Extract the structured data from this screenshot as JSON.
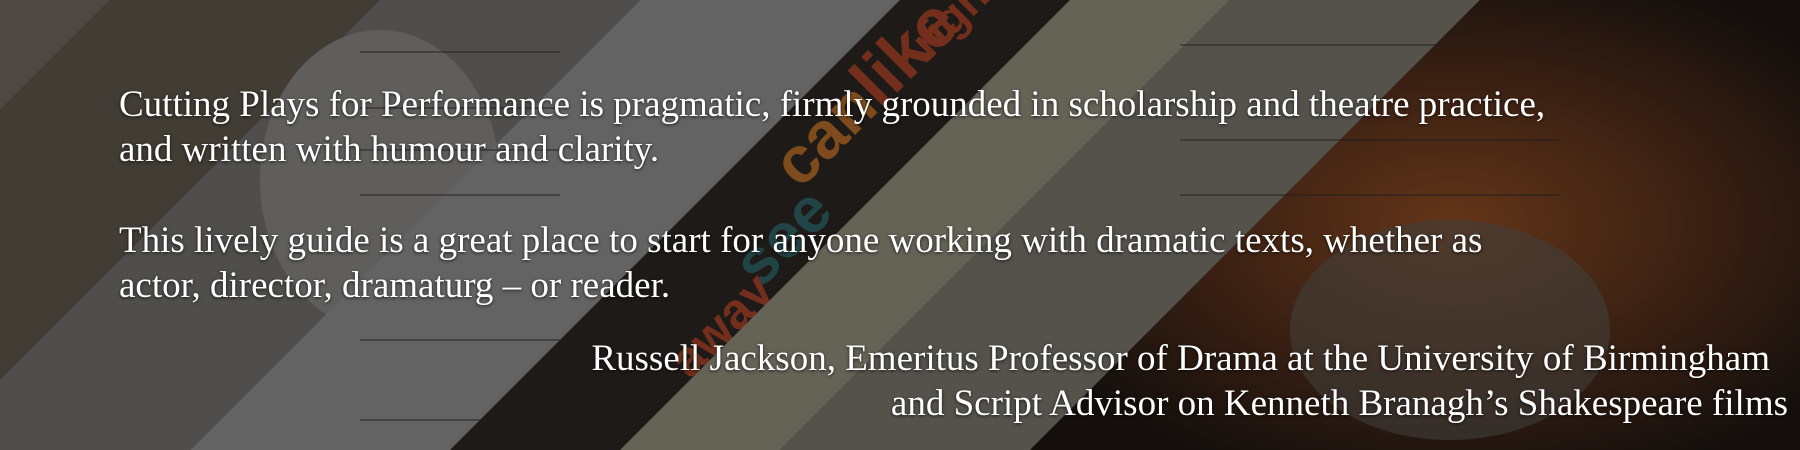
{
  "quote": {
    "line1": "Cutting Plays for Performance is pragmatic, firmly grounded in scholarship and theatre practice,",
    "line2": "and written with humour and clarity.",
    "line3": "This lively guide is a great place to start for anyone working with dramatic texts, whether as",
    "line4": "actor, director, dramaturg – or reader."
  },
  "attribution": {
    "line1": "Russell Jackson, Emeritus Professor of Drama at the University of Birmingham",
    "line2": "and Script Advisor on Kenneth Branagh’s Shakespeare films"
  }
}
